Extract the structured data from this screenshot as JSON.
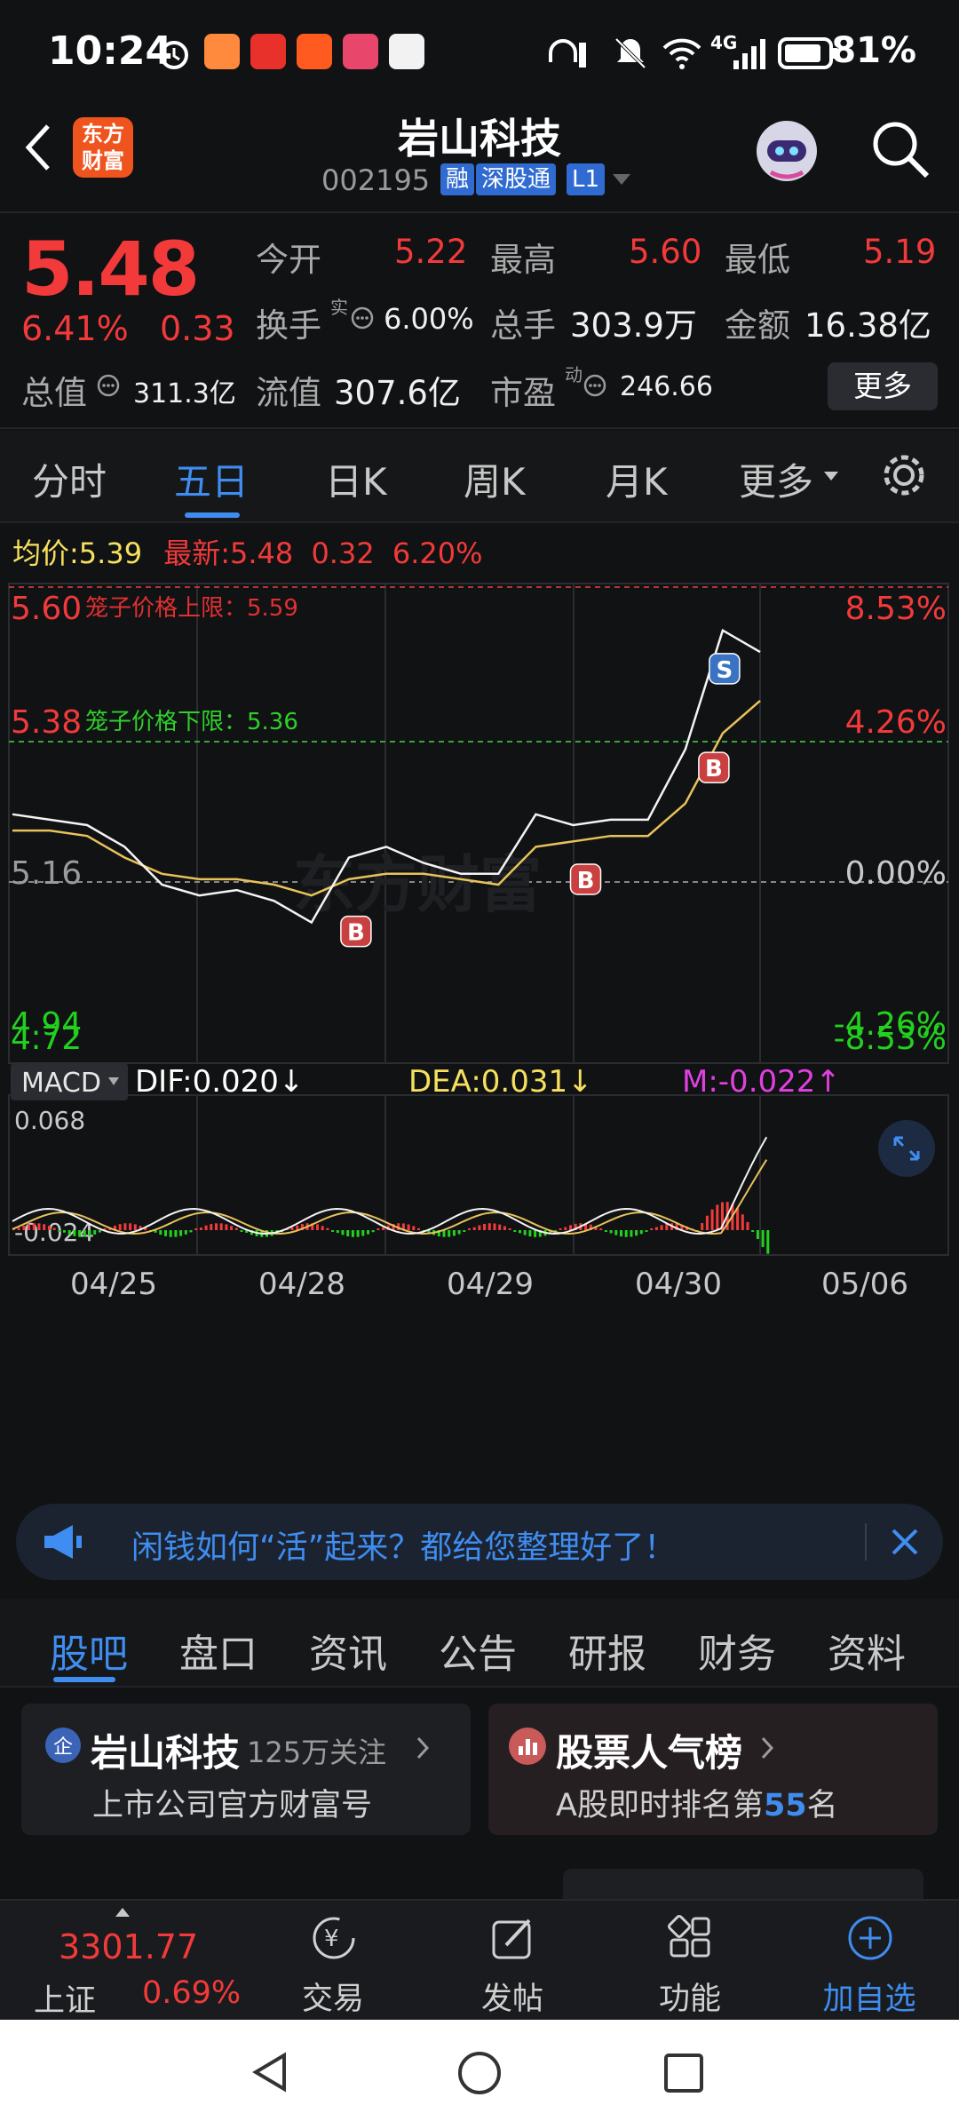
{
  "status_bar": {
    "time": "10:24",
    "battery": "81%",
    "network": "4G"
  },
  "header": {
    "back_label": "<",
    "logo_text": "东方财富",
    "title": "岩山科技",
    "code": "002195",
    "tags": [
      "融",
      "深股通",
      "L1"
    ]
  },
  "quote": {
    "price": "5.48",
    "change_pct": "6.41%",
    "change": "0.33",
    "open_label": "今开",
    "open": "5.22",
    "high_label": "最高",
    "high": "5.60",
    "low_label": "最低",
    "low": "5.19",
    "turnover_label": "换手",
    "turnover_sup": "实",
    "turnover": "6.00%",
    "volume_label": "总手",
    "volume": "303.9万",
    "amount_label": "金额",
    "amount": "16.38亿",
    "mktcap_label": "总值",
    "mktcap": "311.3亿",
    "float_label": "流值",
    "float": "307.6亿",
    "pe_label": "市盈",
    "pe_sup": "动",
    "pe": "246.66",
    "more_button": "更多"
  },
  "period_tabs": [
    "分时",
    "五日",
    "日K",
    "周K",
    "月K",
    "更多"
  ],
  "active_period": "五日",
  "info_row": {
    "avg_label": "均价:",
    "avg": "5.39",
    "latest_label": "最新:",
    "latest": "5.48",
    "latest_change": "0.32",
    "latest_pct": "6.20%"
  },
  "chart_data": [
    {
      "type": "line",
      "xlabels": [
        "04/25",
        "04/28",
        "04/29",
        "04/30",
        "05/06"
      ],
      "ylim": [
        4.72,
        5.6
      ],
      "left_ticks": [
        "5.60",
        "5.38",
        "5.16",
        "4.94",
        "4.72"
      ],
      "right_ticks": [
        "8.53%",
        "4.26%",
        "0.00%",
        "-4.26%",
        "-8.53%"
      ],
      "annotations": [
        "笼子价格上限：5.59",
        "笼子价格下限：5.36"
      ],
      "markers": [
        "B",
        "B",
        "B",
        "S"
      ],
      "series": [
        {
          "values": [
            5.18,
            5.17,
            5.16,
            5.12,
            5.05,
            5.03,
            5.04,
            5.02,
            4.98,
            5.1,
            5.12,
            5.09,
            5.07,
            5.07,
            5.18,
            5.16,
            5.17,
            5.17,
            5.3,
            5.52,
            5.48
          ]
        },
        {
          "values": [
            5.15,
            5.15,
            5.14,
            5.1,
            5.07,
            5.06,
            5.06,
            5.05,
            5.03,
            5.06,
            5.07,
            5.07,
            5.06,
            5.05,
            5.12,
            5.13,
            5.14,
            5.14,
            5.2,
            5.33,
            5.39
          ]
        }
      ]
    },
    {
      "type": "bar",
      "indicator": "MACD",
      "dif_label": "DIF:0.020↓",
      "dea_label": "DEA:0.031↓",
      "m_label": "M:-0.022↑",
      "ylim": [
        -0.024,
        0.068
      ],
      "tick_labels": [
        "0.068",
        "-0.024"
      ]
    }
  ],
  "notice": {
    "text": "闲钱如何“活”起来？都给您整理好了！"
  },
  "content_tabs": [
    "股吧",
    "盘口",
    "资讯",
    "公告",
    "研报",
    "财务",
    "资料"
  ],
  "active_content_tab": "股吧",
  "cards": [
    {
      "title": "岩山科技",
      "extra": "125万关注",
      "sub": "上市公司官方财富号"
    },
    {
      "title": "股票人气榜",
      "sub_prefix": "A股即时排名第",
      "rank": "55",
      "sub_suffix": "名"
    }
  ],
  "bottom_nav": {
    "index_value": "3301.77",
    "index_name": "上证",
    "index_pct": "0.69%",
    "items": [
      "交易",
      "发帖",
      "功能",
      "加自选"
    ]
  }
}
